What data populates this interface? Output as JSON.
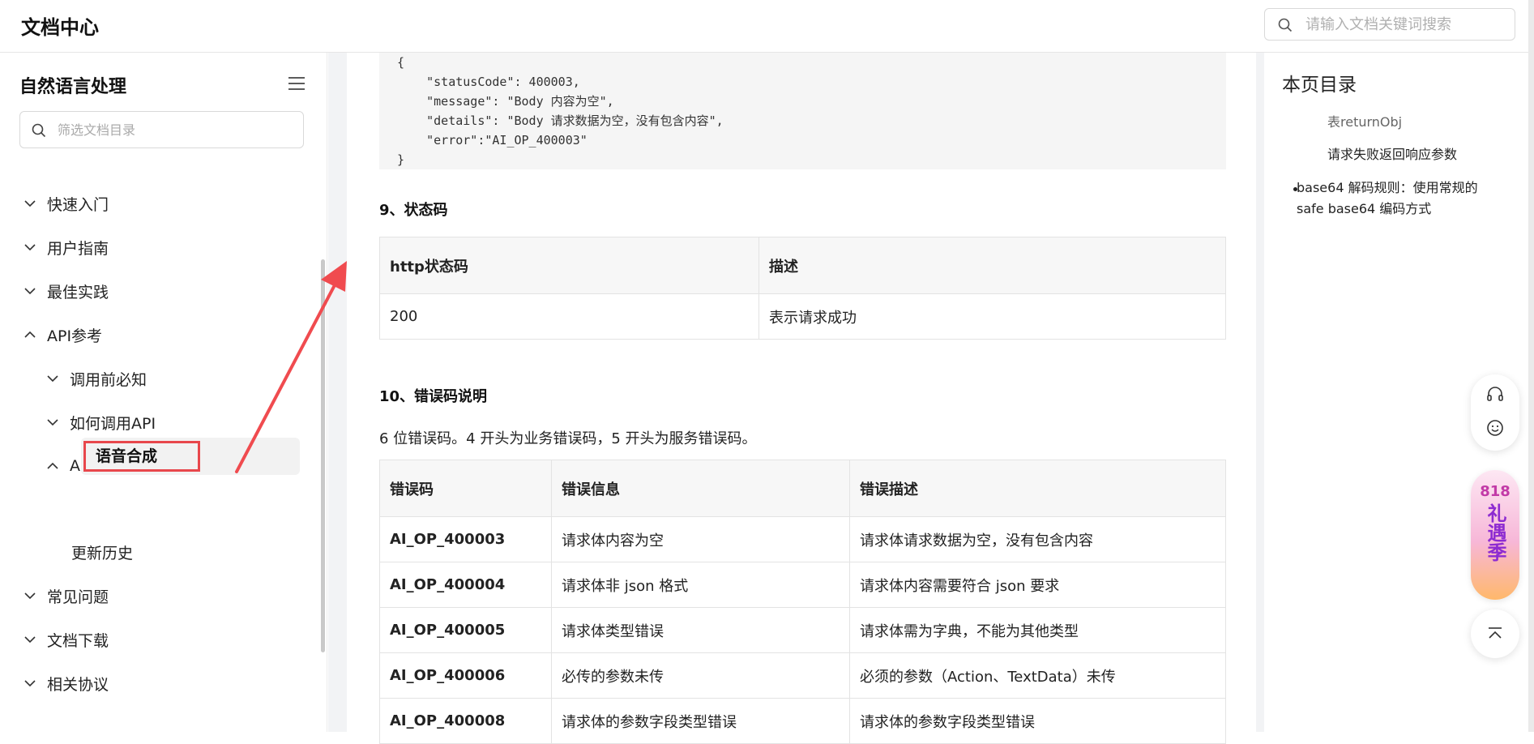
{
  "header": {
    "logo": "文档中心",
    "search_placeholder": "请输入文档关键词搜索"
  },
  "sidebar": {
    "title": "自然语言处理",
    "filter_placeholder": "筛选文档目录",
    "items": [
      {
        "label": "快速入门",
        "state": "collapsed"
      },
      {
        "label": "用户指南",
        "state": "collapsed"
      },
      {
        "label": "最佳实践",
        "state": "collapsed"
      },
      {
        "label": "API参考",
        "state": "expanded"
      },
      {
        "label": "调用前必知",
        "state": "collapsed"
      },
      {
        "label": "如何调用API",
        "state": "collapsed"
      },
      {
        "label": "API",
        "state": "expanded"
      },
      {
        "label": "语音合成",
        "state": "active"
      },
      {
        "label": "更新历史",
        "state": "leaf"
      },
      {
        "label": "常见问题",
        "state": "collapsed"
      },
      {
        "label": "文档下载",
        "state": "collapsed"
      },
      {
        "label": "相关协议",
        "state": "collapsed"
      }
    ]
  },
  "main": {
    "code_lines": [
      "{",
      "    \"statusCode\": 400003,",
      "    \"message\": \"Body 内容为空\",",
      "    \"details\": \"Body 请求数据为空，没有包含内容\",",
      "    \"error\":\"AI_OP_400003\"",
      "}"
    ],
    "section9_title": "9、状态码",
    "status_table": {
      "headers": [
        "http状态码",
        "描述"
      ],
      "rows": [
        [
          "200",
          "表示请求成功"
        ]
      ]
    },
    "section10_title": "10、错误码说明",
    "section10_desc": "6 位错误码。4 开头为业务错误码，5 开头为服务错误码。",
    "error_table": {
      "headers": [
        "错误码",
        "错误信息",
        "错误描述"
      ],
      "rows": [
        [
          "AI_OP_400003",
          "请求体内容为空",
          "请求体请求数据为空，没有包含内容"
        ],
        [
          "AI_OP_400004",
          "请求体非 json 格式",
          "请求体内容需要符合 json 要求"
        ],
        [
          "AI_OP_400005",
          "请求体类型错误",
          "请求体需为字典，不能为其他类型"
        ],
        [
          "AI_OP_400006",
          "必传的参数未传",
          "必须的参数（Action、TextData）未传"
        ],
        [
          "AI_OP_400008",
          "请求体的参数字段类型错误",
          "请求体的参数字段类型错误"
        ]
      ]
    }
  },
  "toc": {
    "title": "本页目录",
    "items": [
      "表returnObj",
      "请求失败返回响应参数",
      "base64 解码规则：使用常规的 safe base64 编码方式"
    ]
  },
  "floating": {
    "promo_top": "818",
    "promo_bottom": "礼遇季"
  },
  "colors": {
    "highlight_box": "#e8474c",
    "annotation_arrow": "#f04b4f"
  }
}
